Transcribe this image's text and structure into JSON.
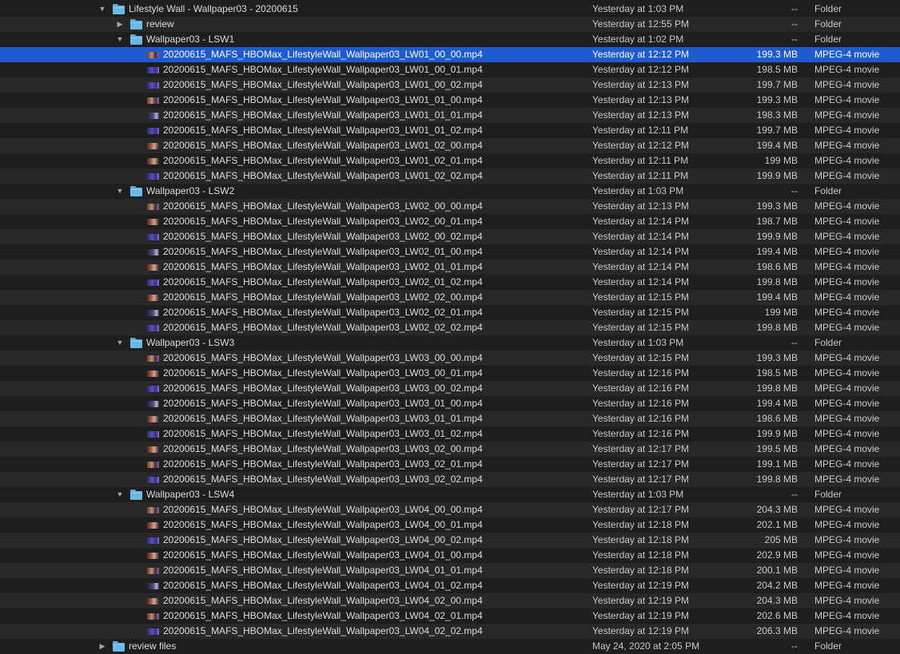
{
  "rows": [
    {
      "type": "folder",
      "level": 0,
      "expanded": true,
      "name": "Lifestyle Wall - Wallpaper03 - 20200615",
      "date": "Yesterday at 1:03 PM",
      "size": "--",
      "kind": "Folder"
    },
    {
      "type": "folder",
      "level": 1,
      "expanded": false,
      "name": "review",
      "date": "Yesterday at 12:55 PM",
      "size": "--",
      "kind": "Folder"
    },
    {
      "type": "folder",
      "level": 1,
      "expanded": true,
      "name": "Wallpaper03 - LSW1",
      "date": "Yesterday at 1:02 PM",
      "size": "--",
      "kind": "Folder"
    },
    {
      "type": "file",
      "level": 2,
      "selected": true,
      "thumb": "a",
      "name": "20200615_MAFS_HBOMax_LifestyleWall_Wallpaper03_LW01_00_00.mp4",
      "date": "Yesterday at 12:12 PM",
      "size": "199.3 MB",
      "kind": "MPEG-4 movie"
    },
    {
      "type": "file",
      "level": 2,
      "thumb": "b",
      "name": "20200615_MAFS_HBOMax_LifestyleWall_Wallpaper03_LW01_00_01.mp4",
      "date": "Yesterday at 12:12 PM",
      "size": "198.5 MB",
      "kind": "MPEG-4 movie"
    },
    {
      "type": "file",
      "level": 2,
      "thumb": "b",
      "name": "20200615_MAFS_HBOMax_LifestyleWall_Wallpaper03_LW01_00_02.mp4",
      "date": "Yesterday at 12:13 PM",
      "size": "199.7 MB",
      "kind": "MPEG-4 movie"
    },
    {
      "type": "file",
      "level": 2,
      "thumb": "a",
      "name": "20200615_MAFS_HBOMax_LifestyleWall_Wallpaper03_LW01_01_00.mp4",
      "date": "Yesterday at 12:13 PM",
      "size": "199.3 MB",
      "kind": "MPEG-4 movie"
    },
    {
      "type": "file",
      "level": 2,
      "thumb": "d",
      "name": "20200615_MAFS_HBOMax_LifestyleWall_Wallpaper03_LW01_01_01.mp4",
      "date": "Yesterday at 12:13 PM",
      "size": "198.3 MB",
      "kind": "MPEG-4 movie"
    },
    {
      "type": "file",
      "level": 2,
      "thumb": "b",
      "name": "20200615_MAFS_HBOMax_LifestyleWall_Wallpaper03_LW01_01_02.mp4",
      "date": "Yesterday at 12:11 PM",
      "size": "199.7 MB",
      "kind": "MPEG-4 movie"
    },
    {
      "type": "file",
      "level": 2,
      "thumb": "c",
      "name": "20200615_MAFS_HBOMax_LifestyleWall_Wallpaper03_LW01_02_00.mp4",
      "date": "Yesterday at 12:12 PM",
      "size": "199.4 MB",
      "kind": "MPEG-4 movie"
    },
    {
      "type": "file",
      "level": 2,
      "thumb": "c",
      "name": "20200615_MAFS_HBOMax_LifestyleWall_Wallpaper03_LW01_02_01.mp4",
      "date": "Yesterday at 12:11 PM",
      "size": "199 MB",
      "kind": "MPEG-4 movie"
    },
    {
      "type": "file",
      "level": 2,
      "thumb": "b",
      "name": "20200615_MAFS_HBOMax_LifestyleWall_Wallpaper03_LW01_02_02.mp4",
      "date": "Yesterday at 12:11 PM",
      "size": "199.9 MB",
      "kind": "MPEG-4 movie"
    },
    {
      "type": "folder",
      "level": 1,
      "expanded": true,
      "name": "Wallpaper03 - LSW2",
      "date": "Yesterday at 1:03 PM",
      "size": "--",
      "kind": "Folder"
    },
    {
      "type": "file",
      "level": 2,
      "thumb": "a",
      "name": "20200615_MAFS_HBOMax_LifestyleWall_Wallpaper03_LW02_00_00.mp4",
      "date": "Yesterday at 12:13 PM",
      "size": "199.3 MB",
      "kind": "MPEG-4 movie"
    },
    {
      "type": "file",
      "level": 2,
      "thumb": "c",
      "name": "20200615_MAFS_HBOMax_LifestyleWall_Wallpaper03_LW02_00_01.mp4",
      "date": "Yesterday at 12:14 PM",
      "size": "198.7 MB",
      "kind": "MPEG-4 movie"
    },
    {
      "type": "file",
      "level": 2,
      "thumb": "b",
      "name": "20200615_MAFS_HBOMax_LifestyleWall_Wallpaper03_LW02_00_02.mp4",
      "date": "Yesterday at 12:14 PM",
      "size": "199.9 MB",
      "kind": "MPEG-4 movie"
    },
    {
      "type": "file",
      "level": 2,
      "thumb": "d",
      "name": "20200615_MAFS_HBOMax_LifestyleWall_Wallpaper03_LW02_01_00.mp4",
      "date": "Yesterday at 12:14 PM",
      "size": "199.4 MB",
      "kind": "MPEG-4 movie"
    },
    {
      "type": "file",
      "level": 2,
      "thumb": "c",
      "name": "20200615_MAFS_HBOMax_LifestyleWall_Wallpaper03_LW02_01_01.mp4",
      "date": "Yesterday at 12:14 PM",
      "size": "198.6 MB",
      "kind": "MPEG-4 movie"
    },
    {
      "type": "file",
      "level": 2,
      "thumb": "b",
      "name": "20200615_MAFS_HBOMax_LifestyleWall_Wallpaper03_LW02_01_02.mp4",
      "date": "Yesterday at 12:14 PM",
      "size": "199.8 MB",
      "kind": "MPEG-4 movie"
    },
    {
      "type": "file",
      "level": 2,
      "thumb": "c",
      "name": "20200615_MAFS_HBOMax_LifestyleWall_Wallpaper03_LW02_02_00.mp4",
      "date": "Yesterday at 12:15 PM",
      "size": "199.4 MB",
      "kind": "MPEG-4 movie"
    },
    {
      "type": "file",
      "level": 2,
      "thumb": "d",
      "name": "20200615_MAFS_HBOMax_LifestyleWall_Wallpaper03_LW02_02_01.mp4",
      "date": "Yesterday at 12:15 PM",
      "size": "199 MB",
      "kind": "MPEG-4 movie"
    },
    {
      "type": "file",
      "level": 2,
      "thumb": "b",
      "name": "20200615_MAFS_HBOMax_LifestyleWall_Wallpaper03_LW02_02_02.mp4",
      "date": "Yesterday at 12:15 PM",
      "size": "199.8 MB",
      "kind": "MPEG-4 movie"
    },
    {
      "type": "folder",
      "level": 1,
      "expanded": true,
      "name": "Wallpaper03 - LSW3",
      "date": "Yesterday at 1:03 PM",
      "size": "--",
      "kind": "Folder"
    },
    {
      "type": "file",
      "level": 2,
      "thumb": "a",
      "name": "20200615_MAFS_HBOMax_LifestyleWall_Wallpaper03_LW03_00_00.mp4",
      "date": "Yesterday at 12:15 PM",
      "size": "199.3 MB",
      "kind": "MPEG-4 movie"
    },
    {
      "type": "file",
      "level": 2,
      "thumb": "c",
      "name": "20200615_MAFS_HBOMax_LifestyleWall_Wallpaper03_LW03_00_01.mp4",
      "date": "Yesterday at 12:16 PM",
      "size": "198.5 MB",
      "kind": "MPEG-4 movie"
    },
    {
      "type": "file",
      "level": 2,
      "thumb": "b",
      "name": "20200615_MAFS_HBOMax_LifestyleWall_Wallpaper03_LW03_00_02.mp4",
      "date": "Yesterday at 12:16 PM",
      "size": "199.8 MB",
      "kind": "MPEG-4 movie"
    },
    {
      "type": "file",
      "level": 2,
      "thumb": "d",
      "name": "20200615_MAFS_HBOMax_LifestyleWall_Wallpaper03_LW03_01_00.mp4",
      "date": "Yesterday at 12:16 PM",
      "size": "199.4 MB",
      "kind": "MPEG-4 movie"
    },
    {
      "type": "file",
      "level": 2,
      "thumb": "c",
      "name": "20200615_MAFS_HBOMax_LifestyleWall_Wallpaper03_LW03_01_01.mp4",
      "date": "Yesterday at 12:16 PM",
      "size": "198.6 MB",
      "kind": "MPEG-4 movie"
    },
    {
      "type": "file",
      "level": 2,
      "thumb": "b",
      "name": "20200615_MAFS_HBOMax_LifestyleWall_Wallpaper03_LW03_01_02.mp4",
      "date": "Yesterday at 12:16 PM",
      "size": "199.9 MB",
      "kind": "MPEG-4 movie"
    },
    {
      "type": "file",
      "level": 2,
      "thumb": "c",
      "name": "20200615_MAFS_HBOMax_LifestyleWall_Wallpaper03_LW03_02_00.mp4",
      "date": "Yesterday at 12:17 PM",
      "size": "199.5 MB",
      "kind": "MPEG-4 movie"
    },
    {
      "type": "file",
      "level": 2,
      "thumb": "a",
      "name": "20200615_MAFS_HBOMax_LifestyleWall_Wallpaper03_LW03_02_01.mp4",
      "date": "Yesterday at 12:17 PM",
      "size": "199.1 MB",
      "kind": "MPEG-4 movie"
    },
    {
      "type": "file",
      "level": 2,
      "thumb": "b",
      "name": "20200615_MAFS_HBOMax_LifestyleWall_Wallpaper03_LW03_02_02.mp4",
      "date": "Yesterday at 12:17 PM",
      "size": "199.8 MB",
      "kind": "MPEG-4 movie"
    },
    {
      "type": "folder",
      "level": 1,
      "expanded": true,
      "name": "Wallpaper03 - LSW4",
      "date": "Yesterday at 1:03 PM",
      "size": "--",
      "kind": "Folder"
    },
    {
      "type": "file",
      "level": 2,
      "thumb": "a",
      "name": "20200615_MAFS_HBOMax_LifestyleWall_Wallpaper03_LW04_00_00.mp4",
      "date": "Yesterday at 12:17 PM",
      "size": "204.3 MB",
      "kind": "MPEG-4 movie"
    },
    {
      "type": "file",
      "level": 2,
      "thumb": "c",
      "name": "20200615_MAFS_HBOMax_LifestyleWall_Wallpaper03_LW04_00_01.mp4",
      "date": "Yesterday at 12:18 PM",
      "size": "202.1 MB",
      "kind": "MPEG-4 movie"
    },
    {
      "type": "file",
      "level": 2,
      "thumb": "b",
      "name": "20200615_MAFS_HBOMax_LifestyleWall_Wallpaper03_LW04_00_02.mp4",
      "date": "Yesterday at 12:18 PM",
      "size": "205 MB",
      "kind": "MPEG-4 movie"
    },
    {
      "type": "file",
      "level": 2,
      "thumb": "c",
      "name": "20200615_MAFS_HBOMax_LifestyleWall_Wallpaper03_LW04_01_00.mp4",
      "date": "Yesterday at 12:18 PM",
      "size": "202.9 MB",
      "kind": "MPEG-4 movie"
    },
    {
      "type": "file",
      "level": 2,
      "thumb": "a",
      "name": "20200615_MAFS_HBOMax_LifestyleWall_Wallpaper03_LW04_01_01.mp4",
      "date": "Yesterday at 12:18 PM",
      "size": "200.1 MB",
      "kind": "MPEG-4 movie"
    },
    {
      "type": "file",
      "level": 2,
      "thumb": "d",
      "name": "20200615_MAFS_HBOMax_LifestyleWall_Wallpaper03_LW04_01_02.mp4",
      "date": "Yesterday at 12:19 PM",
      "size": "204.2 MB",
      "kind": "MPEG-4 movie"
    },
    {
      "type": "file",
      "level": 2,
      "thumb": "c",
      "name": "20200615_MAFS_HBOMax_LifestyleWall_Wallpaper03_LW04_02_00.mp4",
      "date": "Yesterday at 12:19 PM",
      "size": "204.3 MB",
      "kind": "MPEG-4 movie"
    },
    {
      "type": "file",
      "level": 2,
      "thumb": "a",
      "name": "20200615_MAFS_HBOMax_LifestyleWall_Wallpaper03_LW04_02_01.mp4",
      "date": "Yesterday at 12:19 PM",
      "size": "202.6 MB",
      "kind": "MPEG-4 movie"
    },
    {
      "type": "file",
      "level": 2,
      "thumb": "b",
      "name": "20200615_MAFS_HBOMax_LifestyleWall_Wallpaper03_LW04_02_02.mp4",
      "date": "Yesterday at 12:19 PM",
      "size": "206.3 MB",
      "kind": "MPEG-4 movie"
    },
    {
      "type": "folder",
      "level": 0,
      "expanded": false,
      "name": "review files",
      "date": "May 24, 2020 at 2:05 PM",
      "size": "--",
      "kind": "Folder"
    }
  ],
  "colors": {
    "background": "#1e1e1e",
    "alt_row": "#282828",
    "selection": "#1f5bd0",
    "folder_blue": "#6ab8e4"
  },
  "icons": {
    "expanded": "disclosure-triangle-down-icon",
    "collapsed": "disclosure-triangle-right-icon",
    "folder": "folder-icon",
    "video": "video-thumbnail-icon"
  }
}
